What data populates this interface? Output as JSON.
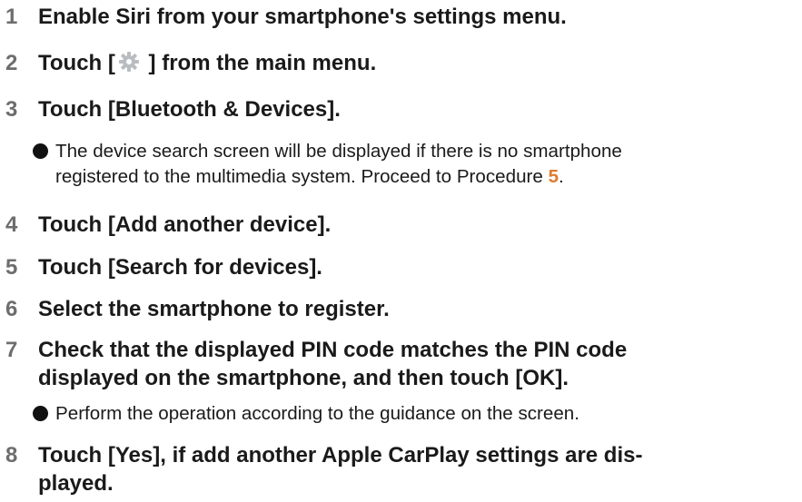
{
  "steps": [
    {
      "num": "1",
      "text": "Enable Siri from your smartphone's settings menu."
    },
    {
      "num": "2",
      "text_before": "Touch [",
      "icon": "gear-icon",
      "text_after": " ] from the main menu."
    },
    {
      "num": "3",
      "text": "Touch [Bluetooth & Devices]."
    },
    {
      "num": "4",
      "text": "Touch [Add another device]."
    },
    {
      "num": "5",
      "text": "Touch [Search for devices]."
    },
    {
      "num": "6",
      "text": "Select the smartphone to register."
    },
    {
      "num": "7",
      "line1": "Check that the displayed PIN code matches the PIN code",
      "line2": "displayed on the smartphone, and then touch [OK]."
    },
    {
      "num": "8",
      "line1": "Touch [Yes], if add another Apple CarPlay settings are dis-",
      "line2": "played."
    }
  ],
  "notes": {
    "after_step_3": {
      "line1": "The device search screen will be displayed if there is no smartphone",
      "line2_before": "registered to the multimedia system. Proceed to Procedure ",
      "procedure_ref": "5",
      "line2_after": "."
    },
    "after_step_7": {
      "text": "Perform the operation according to the guidance on the screen."
    }
  },
  "colors": {
    "step_number": "#6d6d6d",
    "text": "#1a1a1a",
    "procedure_ref": "#e07a2e",
    "gear_icon": "#b9bcc0"
  }
}
